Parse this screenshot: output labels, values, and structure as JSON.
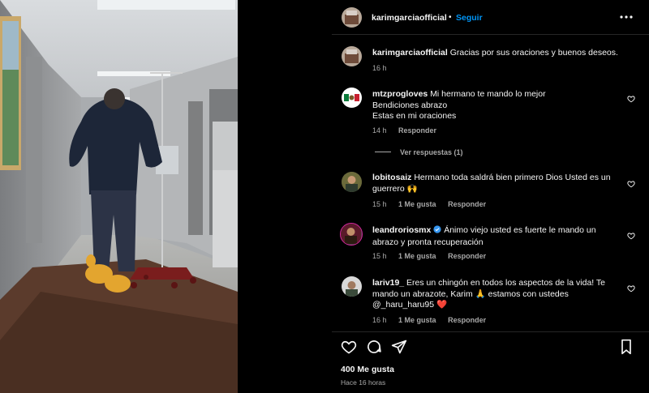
{
  "post": {
    "username": "karimgarciaofficial",
    "dot": "•",
    "follow_label": "Seguir",
    "caption": "Gracias por sus oraciones y buenos deseos.",
    "caption_time": "16 h"
  },
  "comments": [
    {
      "username": "mtzprogloves",
      "lines": [
        "Mi hermano te mando lo mejor",
        "Bendiciones abrazo",
        "Estas en mi oraciones"
      ],
      "time": "14 h",
      "likes": "",
      "reply": "Responder",
      "view_replies": "Ver respuestas (1)"
    },
    {
      "username": "lobitosaiz",
      "lines": [
        "Hermano toda saldrá bien primero Dios Usted es un",
        "guerrero 🙌"
      ],
      "time": "15 h",
      "likes": "1 Me gusta",
      "reply": "Responder"
    },
    {
      "username": "leandroriosmx",
      "lines": [
        "Ánimo viejo usted es fuerte le mando un",
        "abrazo y pronta recuperación"
      ],
      "time": "15 h",
      "likes": "1 Me gusta",
      "reply": "Responder"
    },
    {
      "username": "lariv19_",
      "lines": [
        "Eres un chingón en todos los aspectos de la vida! Te",
        "mando un abrazote, Karim 🙏 estamos con ustedes",
        "@_haru_haru95 ❤️"
      ],
      "time": "16 h",
      "likes": "1 Me gusta",
      "reply": "Responder"
    }
  ],
  "footer": {
    "likes": "400 Me gusta",
    "time": "Hace 16 horas"
  },
  "icons": [
    "more-icon",
    "heart-icon",
    "comment-icon",
    "share-icon",
    "bookmark-icon",
    "verified-badge-icon"
  ],
  "colors": {
    "accent": "#0095f6",
    "background": "#000000",
    "secondary_text": "#a8a8a8",
    "verified": "#3797f0"
  }
}
